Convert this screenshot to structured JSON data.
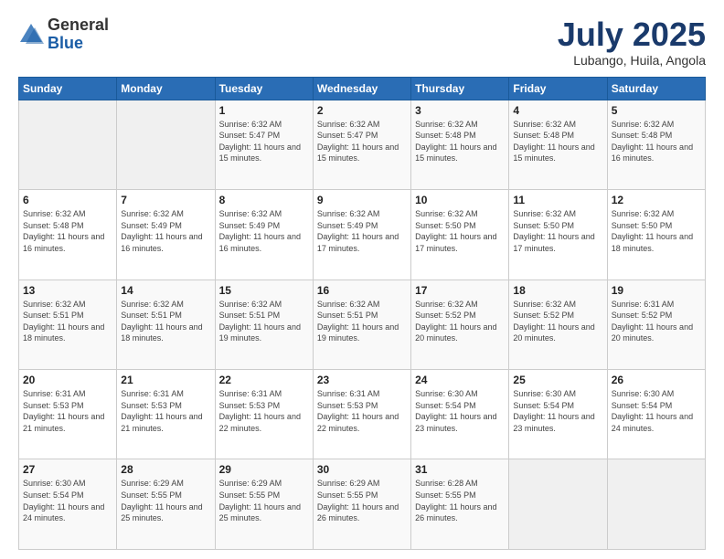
{
  "logo": {
    "general": "General",
    "blue": "Blue"
  },
  "header": {
    "month": "July 2025",
    "location": "Lubango, Huila, Angola"
  },
  "weekdays": [
    "Sunday",
    "Monday",
    "Tuesday",
    "Wednesday",
    "Thursday",
    "Friday",
    "Saturday"
  ],
  "weeks": [
    [
      {
        "day": "",
        "sunrise": "",
        "sunset": "",
        "daylight": ""
      },
      {
        "day": "",
        "sunrise": "",
        "sunset": "",
        "daylight": ""
      },
      {
        "day": "1",
        "sunrise": "Sunrise: 6:32 AM",
        "sunset": "Sunset: 5:47 PM",
        "daylight": "Daylight: 11 hours and 15 minutes."
      },
      {
        "day": "2",
        "sunrise": "Sunrise: 6:32 AM",
        "sunset": "Sunset: 5:47 PM",
        "daylight": "Daylight: 11 hours and 15 minutes."
      },
      {
        "day": "3",
        "sunrise": "Sunrise: 6:32 AM",
        "sunset": "Sunset: 5:48 PM",
        "daylight": "Daylight: 11 hours and 15 minutes."
      },
      {
        "day": "4",
        "sunrise": "Sunrise: 6:32 AM",
        "sunset": "Sunset: 5:48 PM",
        "daylight": "Daylight: 11 hours and 15 minutes."
      },
      {
        "day": "5",
        "sunrise": "Sunrise: 6:32 AM",
        "sunset": "Sunset: 5:48 PM",
        "daylight": "Daylight: 11 hours and 16 minutes."
      }
    ],
    [
      {
        "day": "6",
        "sunrise": "Sunrise: 6:32 AM",
        "sunset": "Sunset: 5:48 PM",
        "daylight": "Daylight: 11 hours and 16 minutes."
      },
      {
        "day": "7",
        "sunrise": "Sunrise: 6:32 AM",
        "sunset": "Sunset: 5:49 PM",
        "daylight": "Daylight: 11 hours and 16 minutes."
      },
      {
        "day": "8",
        "sunrise": "Sunrise: 6:32 AM",
        "sunset": "Sunset: 5:49 PM",
        "daylight": "Daylight: 11 hours and 16 minutes."
      },
      {
        "day": "9",
        "sunrise": "Sunrise: 6:32 AM",
        "sunset": "Sunset: 5:49 PM",
        "daylight": "Daylight: 11 hours and 17 minutes."
      },
      {
        "day": "10",
        "sunrise": "Sunrise: 6:32 AM",
        "sunset": "Sunset: 5:50 PM",
        "daylight": "Daylight: 11 hours and 17 minutes."
      },
      {
        "day": "11",
        "sunrise": "Sunrise: 6:32 AM",
        "sunset": "Sunset: 5:50 PM",
        "daylight": "Daylight: 11 hours and 17 minutes."
      },
      {
        "day": "12",
        "sunrise": "Sunrise: 6:32 AM",
        "sunset": "Sunset: 5:50 PM",
        "daylight": "Daylight: 11 hours and 18 minutes."
      }
    ],
    [
      {
        "day": "13",
        "sunrise": "Sunrise: 6:32 AM",
        "sunset": "Sunset: 5:51 PM",
        "daylight": "Daylight: 11 hours and 18 minutes."
      },
      {
        "day": "14",
        "sunrise": "Sunrise: 6:32 AM",
        "sunset": "Sunset: 5:51 PM",
        "daylight": "Daylight: 11 hours and 18 minutes."
      },
      {
        "day": "15",
        "sunrise": "Sunrise: 6:32 AM",
        "sunset": "Sunset: 5:51 PM",
        "daylight": "Daylight: 11 hours and 19 minutes."
      },
      {
        "day": "16",
        "sunrise": "Sunrise: 6:32 AM",
        "sunset": "Sunset: 5:51 PM",
        "daylight": "Daylight: 11 hours and 19 minutes."
      },
      {
        "day": "17",
        "sunrise": "Sunrise: 6:32 AM",
        "sunset": "Sunset: 5:52 PM",
        "daylight": "Daylight: 11 hours and 20 minutes."
      },
      {
        "day": "18",
        "sunrise": "Sunrise: 6:32 AM",
        "sunset": "Sunset: 5:52 PM",
        "daylight": "Daylight: 11 hours and 20 minutes."
      },
      {
        "day": "19",
        "sunrise": "Sunrise: 6:31 AM",
        "sunset": "Sunset: 5:52 PM",
        "daylight": "Daylight: 11 hours and 20 minutes."
      }
    ],
    [
      {
        "day": "20",
        "sunrise": "Sunrise: 6:31 AM",
        "sunset": "Sunset: 5:53 PM",
        "daylight": "Daylight: 11 hours and 21 minutes."
      },
      {
        "day": "21",
        "sunrise": "Sunrise: 6:31 AM",
        "sunset": "Sunset: 5:53 PM",
        "daylight": "Daylight: 11 hours and 21 minutes."
      },
      {
        "day": "22",
        "sunrise": "Sunrise: 6:31 AM",
        "sunset": "Sunset: 5:53 PM",
        "daylight": "Daylight: 11 hours and 22 minutes."
      },
      {
        "day": "23",
        "sunrise": "Sunrise: 6:31 AM",
        "sunset": "Sunset: 5:53 PM",
        "daylight": "Daylight: 11 hours and 22 minutes."
      },
      {
        "day": "24",
        "sunrise": "Sunrise: 6:30 AM",
        "sunset": "Sunset: 5:54 PM",
        "daylight": "Daylight: 11 hours and 23 minutes."
      },
      {
        "day": "25",
        "sunrise": "Sunrise: 6:30 AM",
        "sunset": "Sunset: 5:54 PM",
        "daylight": "Daylight: 11 hours and 23 minutes."
      },
      {
        "day": "26",
        "sunrise": "Sunrise: 6:30 AM",
        "sunset": "Sunset: 5:54 PM",
        "daylight": "Daylight: 11 hours and 24 minutes."
      }
    ],
    [
      {
        "day": "27",
        "sunrise": "Sunrise: 6:30 AM",
        "sunset": "Sunset: 5:54 PM",
        "daylight": "Daylight: 11 hours and 24 minutes."
      },
      {
        "day": "28",
        "sunrise": "Sunrise: 6:29 AM",
        "sunset": "Sunset: 5:55 PM",
        "daylight": "Daylight: 11 hours and 25 minutes."
      },
      {
        "day": "29",
        "sunrise": "Sunrise: 6:29 AM",
        "sunset": "Sunset: 5:55 PM",
        "daylight": "Daylight: 11 hours and 25 minutes."
      },
      {
        "day": "30",
        "sunrise": "Sunrise: 6:29 AM",
        "sunset": "Sunset: 5:55 PM",
        "daylight": "Daylight: 11 hours and 26 minutes."
      },
      {
        "day": "31",
        "sunrise": "Sunrise: 6:28 AM",
        "sunset": "Sunset: 5:55 PM",
        "daylight": "Daylight: 11 hours and 26 minutes."
      },
      {
        "day": "",
        "sunrise": "",
        "sunset": "",
        "daylight": ""
      },
      {
        "day": "",
        "sunrise": "",
        "sunset": "",
        "daylight": ""
      }
    ]
  ]
}
